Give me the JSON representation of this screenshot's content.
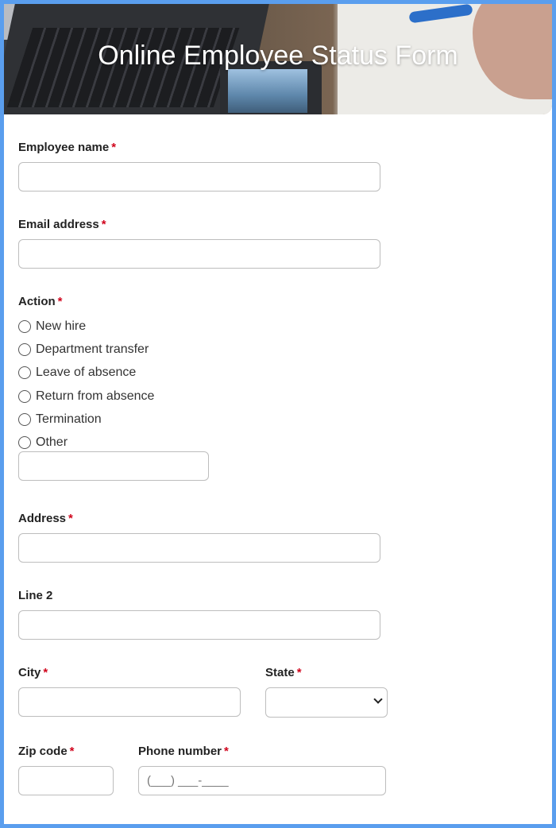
{
  "form": {
    "title": "Online Employee Status Form",
    "required_marker": "*",
    "employee_name": {
      "label": "Employee name",
      "value": ""
    },
    "email": {
      "label": "Email address",
      "value": ""
    },
    "action": {
      "label": "Action",
      "options": [
        "New hire",
        "Department transfer",
        "Leave of absence",
        "Return from absence",
        "Termination",
        "Other"
      ],
      "other_value": ""
    },
    "address": {
      "label": "Address",
      "value": ""
    },
    "line2": {
      "label": "Line 2",
      "value": ""
    },
    "city": {
      "label": "City",
      "value": ""
    },
    "state": {
      "label": "State",
      "selected": ""
    },
    "zip": {
      "label": "Zip code",
      "value": ""
    },
    "phone": {
      "label": "Phone number",
      "placeholder": "(___) ___-____"
    }
  },
  "colors": {
    "frame_border": "#5a9eee",
    "required": "#d0021b",
    "input_border": "#bdbdbd"
  },
  "icons": [
    "radio-circle-icon",
    "chevron-down-icon"
  ]
}
